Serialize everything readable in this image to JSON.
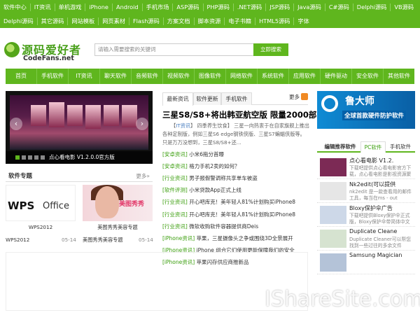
{
  "categories_row1": [
    "软件中心",
    "IT资讯",
    "单机游戏",
    "iPhone",
    "Android",
    "手机市场",
    "ASP源码",
    "PHP源码",
    ".NET源码",
    "JSP源码",
    "Java源码",
    "C#源码",
    "Delphi源码",
    "VB源码"
  ],
  "categories_row2": [
    "Delphi源码",
    "其它源码",
    "网站模板",
    "网页素材",
    "Flash源码",
    "方案文档",
    "脚本资源",
    "电子书籍",
    "HTML5源码",
    "字体"
  ],
  "logo": {
    "cn": "源码爱好者",
    "en": "CodeFans.net"
  },
  "search": {
    "placeholder": "请输入需要搜索的关键词",
    "button": "立即搜索"
  },
  "main_nav": [
    "首页",
    "手机软件",
    "IT资讯",
    "聊天软件",
    "音频软件",
    "视频软件",
    "图像软件",
    "网络软件",
    "系统软件",
    "应用软件",
    "硬件驱动",
    "安全软件",
    "其他软件"
  ],
  "slideshow": {
    "caption": "点心看电影 V1.2.0.0官方版",
    "dots": [
      1,
      2,
      3,
      4,
      5
    ]
  },
  "tabs": [
    "最新资讯",
    "软件更新",
    "手机软件"
  ],
  "more": "更多",
  "headline": "三星S8/S8+将出韩亚航空版 限量2000部",
  "summary": {
    "prefix": "【",
    "tag": "IT资讯",
    "body": "】 四季养生饮食】 三星一向热衷于在自家旗舰上推出各种定制版，例如三星S6 edge钢铁侠版、三星S7蝙蝠侠版等。只是万万没想到，三星S8/S8+还..."
  },
  "news_group1": [
    {
      "tag": "[安卓资讯]",
      "title": "小米6拖分首曝"
    },
    {
      "tag": "[安卓资讯]",
      "title": "格力手机2卖的如何？"
    },
    {
      "tag": "[行业资讯]",
      "title": "男子报假警调称共享单车被盗"
    },
    {
      "tag": "[软件评测]",
      "title": "小米贷款App正式上线"
    },
    {
      "tag": "[行业资讯]",
      "title": "开心吧库克！美年轻人81%计划购买iPhone8"
    }
  ],
  "news_group2": [
    {
      "tag": "[行业资讯]",
      "title": "开心吧库克！美年轻人81%计划购买iPhone8"
    },
    {
      "tag": "[行业资讯]",
      "title": "微软收购软件容器提供商Deis"
    },
    {
      "tag": "[iPhone资讯]",
      "title": "苹果，三星摄像头之争或围绕3D全景展开"
    },
    {
      "tag": "[iPhone资讯]",
      "title": "iPhone 组合它们使用更能保障我们的安全"
    },
    {
      "tag": "[iPhone资讯]",
      "title": "苹果闪存供应商推新品"
    }
  ],
  "ad_banner": {
    "title": "鲁大师",
    "subtitle": "全球首款硬件防护软件"
  },
  "editor_tabs": [
    "编辑推荐软件",
    "PC软件",
    "手机软件"
  ],
  "editor_picks": [
    {
      "title": "点心看电影 V1.2.",
      "desc": "下载吧提供点心看电影官方下载，点心看电影是影视资源聚合播放，用户"
    },
    {
      "title": "Nk2edit(可以提供",
      "desc": "nk2edit 是一款查看用的邮件工具，每当在ms - out"
    },
    {
      "title": "Bloxy保护伞广告",
      "desc": "下载吧提供Bloxy保护伞正式版，Bloxy保护伞带简体中文"
    },
    {
      "title": "Duplicate Cleane",
      "desc": "Duplicate Cleaner可以帮您找到一些过往的多余文件"
    },
    {
      "title": "Samsung Magician",
      "desc": ""
    }
  ],
  "topics": {
    "title": "软件专题",
    "more": "更多»",
    "items": [
      {
        "caption": "WPS2012",
        "logo_text_1": "WPS",
        "logo_text_2": "Office"
      },
      {
        "caption": "美图秀秀美容专题",
        "logo_text": "美图秀秀"
      }
    ],
    "list": [
      {
        "title": "WPS2012",
        "date": "05-14"
      },
      {
        "title": "美图秀秀美容专题",
        "date": "05-14"
      }
    ]
  },
  "watermark": "IShareSite.com"
}
